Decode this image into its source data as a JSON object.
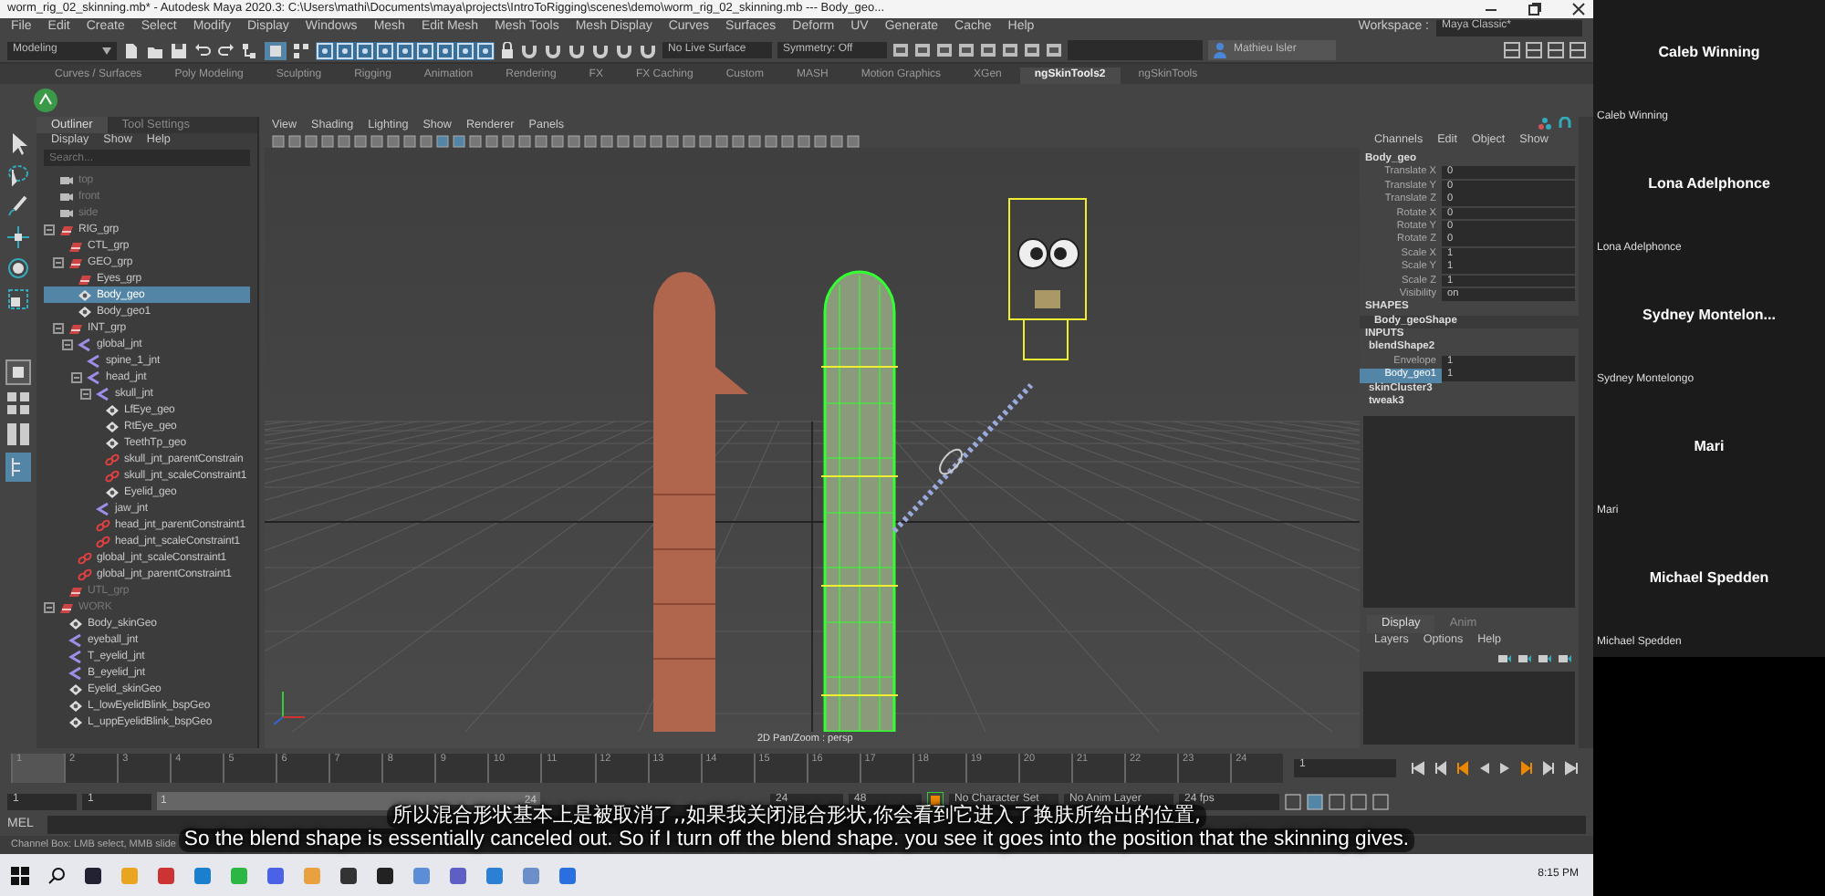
{
  "window": {
    "title": "worm_rig_02_skinning.mb* - Autodesk Maya 2020.3: C:\\Users\\mathi\\Documents\\maya\\projects\\IntroToRigging\\scenes\\demo\\worm_rig_02_skinning.mb  ---  Body_geo..."
  },
  "menu_bar": [
    "File",
    "Edit",
    "Create",
    "Select",
    "Modify",
    "Display",
    "Windows",
    "Mesh",
    "Edit Mesh",
    "Mesh Tools",
    "Mesh Display",
    "Curves",
    "Surfaces",
    "Deform",
    "UV",
    "Generate",
    "Cache",
    "Help"
  ],
  "toolbar": {
    "mode": "Modeling",
    "live_surface": "No Live Surface",
    "symmetry": "Symmetry: Off",
    "user": "Mathieu Isler",
    "workspace_label": "Workspace :",
    "workspace": "Maya Classic*"
  },
  "shelf_tabs": [
    {
      "label": "Curves / Surfaces",
      "selected": false
    },
    {
      "label": "Poly Modeling",
      "selected": false
    },
    {
      "label": "Sculpting",
      "selected": false
    },
    {
      "label": "Rigging",
      "selected": false
    },
    {
      "label": "Animation",
      "selected": false
    },
    {
      "label": "Rendering",
      "selected": false
    },
    {
      "label": "FX",
      "selected": false
    },
    {
      "label": "FX Caching",
      "selected": false
    },
    {
      "label": "Custom",
      "selected": false
    },
    {
      "label": "MASH",
      "selected": false
    },
    {
      "label": "Motion Graphics",
      "selected": false
    },
    {
      "label": "XGen",
      "selected": false
    },
    {
      "label": "ngSkinTools2",
      "selected": true
    },
    {
      "label": "ngSkinTools",
      "selected": false
    }
  ],
  "outliner": {
    "tabs": [
      {
        "label": "Outliner",
        "selected": true
      },
      {
        "label": "Tool Settings",
        "selected": false
      }
    ],
    "menu": [
      "Display",
      "Show",
      "Help"
    ],
    "search_placeholder": "Search...",
    "tree": [
      {
        "label": "top",
        "kind": "camera",
        "selected": false,
        "dimmed": true
      },
      {
        "label": "front",
        "kind": "camera",
        "selected": false,
        "dimmed": true
      },
      {
        "label": "side",
        "kind": "camera",
        "selected": false,
        "dimmed": true
      },
      {
        "label": "RIG_grp",
        "kind": "group",
        "selected": false,
        "dimmed": false,
        "children": [
          {
            "label": "CTL_grp",
            "kind": "group",
            "selected": false,
            "dimmed": false
          },
          {
            "label": "GEO_grp",
            "kind": "group",
            "selected": false,
            "dimmed": false,
            "children": [
              {
                "label": "Eyes_grp",
                "kind": "group",
                "selected": false,
                "dimmed": false
              },
              {
                "label": "Body_geo",
                "kind": "mesh",
                "selected": true,
                "dimmed": false
              },
              {
                "label": "Body_geo1",
                "kind": "mesh",
                "selected": false,
                "dimmed": false
              }
            ]
          },
          {
            "label": "INT_grp",
            "kind": "group",
            "selected": false,
            "dimmed": false,
            "children": [
              {
                "label": "global_jnt",
                "kind": "joint",
                "selected": false,
                "dimmed": false,
                "children": [
                  {
                    "label": "spine_1_jnt",
                    "kind": "joint",
                    "selected": false,
                    "dimmed": false
                  },
                  {
                    "label": "head_jnt",
                    "kind": "joint",
                    "selected": false,
                    "dimmed": false,
                    "children": [
                      {
                        "label": "skull_jnt",
                        "kind": "joint",
                        "selected": false,
                        "dimmed": false,
                        "children": [
                          {
                            "label": "LfEye_geo",
                            "kind": "mesh",
                            "selected": false,
                            "dimmed": false
                          },
                          {
                            "label": "RtEye_geo",
                            "kind": "mesh",
                            "selected": false,
                            "dimmed": false
                          },
                          {
                            "label": "TeethTp_geo",
                            "kind": "mesh",
                            "selected": false,
                            "dimmed": false
                          },
                          {
                            "label": "skull_jnt_parentConstrain",
                            "kind": "constraint",
                            "selected": false,
                            "dimmed": false
                          },
                          {
                            "label": "skull_jnt_scaleConstraint1",
                            "kind": "constraint",
                            "selected": false,
                            "dimmed": false
                          },
                          {
                            "label": "Eyelid_geo",
                            "kind": "mesh",
                            "selected": false,
                            "dimmed": false
                          }
                        ]
                      },
                      {
                        "label": "jaw_jnt",
                        "kind": "joint",
                        "selected": false,
                        "dimmed": false
                      },
                      {
                        "label": "head_jnt_parentConstraint1",
                        "kind": "constraint",
                        "selected": false,
                        "dimmed": false
                      },
                      {
                        "label": "head_jnt_scaleConstraint1",
                        "kind": "constraint",
                        "selected": false,
                        "dimmed": false
                      }
                    ]
                  }
                ]
              },
              {
                "label": "global_jnt_scaleConstraint1",
                "kind": "constraint",
                "selected": false,
                "dimmed": false
              },
              {
                "label": "global_jnt_parentConstraint1",
                "kind": "constraint",
                "selected": false,
                "dimmed": false
              }
            ]
          },
          {
            "label": "UTL_grp",
            "kind": "group",
            "selected": false,
            "dimmed": true
          }
        ]
      },
      {
        "label": "WORK",
        "kind": "group",
        "selected": false,
        "dimmed": true,
        "children": [
          {
            "label": "Body_skinGeo",
            "kind": "mesh",
            "selected": false,
            "dimmed": false
          },
          {
            "label": "eyeball_jnt",
            "kind": "joint",
            "selected": false,
            "dimmed": false
          },
          {
            "label": "T_eyelid_jnt",
            "kind": "joint",
            "selected": false,
            "dimmed": false
          },
          {
            "label": "B_eyelid_jnt",
            "kind": "joint",
            "selected": false,
            "dimmed": false
          },
          {
            "label": "Eyelid_skinGeo",
            "kind": "mesh",
            "selected": false,
            "dimmed": false
          },
          {
            "label": "L_lowEyelidBlink_bspGeo",
            "kind": "mesh",
            "selected": false,
            "dimmed": false
          },
          {
            "label": "L_uppEyelidBlink_bspGeo",
            "kind": "mesh",
            "selected": false,
            "dimmed": false
          }
        ]
      }
    ]
  },
  "viewport": {
    "menu": [
      "View",
      "Shading",
      "Lighting",
      "Show",
      "Renderer",
      "Panels"
    ],
    "camera_label": "2D Pan/Zoom : persp"
  },
  "channel_box": {
    "menu": [
      "Channels",
      "Edit",
      "Object",
      "Show"
    ],
    "object": "Body_geo",
    "attributes": [
      {
        "name": "Translate X",
        "value": "0"
      },
      {
        "name": "Translate Y",
        "value": "0"
      },
      {
        "name": "Translate Z",
        "value": "0"
      },
      {
        "name": "Rotate X",
        "value": "0"
      },
      {
        "name": "Rotate Y",
        "value": "0"
      },
      {
        "name": "Rotate Z",
        "value": "0"
      },
      {
        "name": "Scale X",
        "value": "1"
      },
      {
        "name": "Scale Y",
        "value": "1"
      },
      {
        "name": "Scale Z",
        "value": "1"
      },
      {
        "name": "Visibility",
        "value": "on"
      }
    ],
    "shapes_heading": "SHAPES",
    "shape": "Body_geoShape",
    "inputs_heading": "INPUTS",
    "inputs": [
      {
        "name": "blendShape2",
        "attributes": [
          {
            "name": "Envelope",
            "value": "1",
            "selected": false
          },
          {
            "name": "Body_geo1",
            "value": "1",
            "selected": true
          }
        ]
      },
      {
        "name": "skinCluster3"
      },
      {
        "name": "tweak3"
      }
    ]
  },
  "layer_editor": {
    "tabs": [
      {
        "label": "Display",
        "selected": true
      },
      {
        "label": "Anim",
        "selected": false
      }
    ],
    "menu": [
      "Layers",
      "Options",
      "Help"
    ]
  },
  "timeline": {
    "ticks": [
      "1",
      "2",
      "3",
      "4",
      "5",
      "6",
      "7",
      "8",
      "9",
      "10",
      "11",
      "12",
      "13",
      "14",
      "15",
      "16",
      "17",
      "18",
      "19",
      "20",
      "21",
      "22",
      "23",
      "24"
    ],
    "current_frame": "1"
  },
  "range": {
    "start": "1",
    "playback_start": "1",
    "slider_start": "1",
    "slider_end": "24",
    "playback_end": "24",
    "end": "48",
    "character_set": "No Character Set",
    "anim_layer": "No Anim Layer",
    "fps": "24 fps"
  },
  "command_line": {
    "label": "MEL"
  },
  "help_line": "Channel Box: LMB select, MMB slide",
  "subtitles": {
    "zh": "所以混合形状基本上是被取消了,,如果我关闭混合形状,你会看到它进入了换肤所给出的位置,",
    "en": "So the blend shape is essentially canceled out. So if I turn off the blend shape. you see it goes into the position that the skinning gives."
  },
  "taskbar": {
    "clock": "8:15 PM"
  },
  "participants": [
    {
      "tile_name": "Caleb Winning",
      "label": "Caleb Winning"
    },
    {
      "tile_name": "Lona Adelphonce",
      "label": "Lona Adelphonce"
    },
    {
      "tile_name": "Sydney  Montelon...",
      "label": "Sydney Montelongo"
    },
    {
      "tile_name": "Mari",
      "label": "Mari"
    },
    {
      "tile_name": "Michael Spedden",
      "label": "Michael Spedden"
    }
  ]
}
